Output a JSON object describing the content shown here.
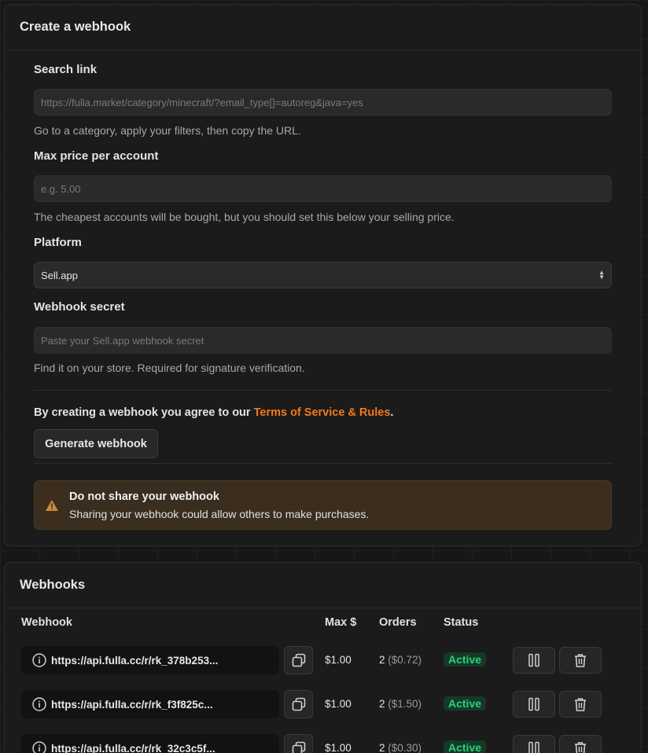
{
  "create": {
    "title": "Create a webhook",
    "search_link": {
      "label": "Search link",
      "placeholder": "https://fulla.market/category/minecraft/?email_type[]=autoreg&java=yes",
      "help": "Go to a category, apply your filters, then copy the URL."
    },
    "max_price": {
      "label": "Max price per account",
      "placeholder": "e.g. 5.00",
      "help": "The cheapest accounts will be bought, but you should set this below your selling price."
    },
    "platform": {
      "label": "Platform",
      "selected": "Sell.app"
    },
    "secret": {
      "label": "Webhook secret",
      "placeholder": "Paste your Sell.app webhook secret",
      "help": "Find it on your store. Required for signature verification."
    },
    "agree_text": "By creating a webhook you agree to our ",
    "agree_link": "Terms of Service & Rules",
    "agree_end": ".",
    "generate_label": "Generate webhook",
    "alert": {
      "title": "Do not share your webhook",
      "text": "Sharing your webhook could allow others to make purchases."
    },
    "colors": {
      "accent": "#f07a1e",
      "warning_bg": "#3b2e1f",
      "active": "#2ad27a"
    }
  },
  "webhooks": {
    "title": "Webhooks",
    "columns": [
      "Webhook",
      "Max $",
      "Orders",
      "Status"
    ],
    "rows": [
      {
        "url": "https://api.fulla.cc/r/rk_378b253...",
        "max": "$1.00",
        "orders": "2",
        "orders_total": "($0.72)",
        "status": "Active"
      },
      {
        "url": "https://api.fulla.cc/r/rk_f3f825c...",
        "max": "$1.00",
        "orders": "2",
        "orders_total": "($1.50)",
        "status": "Active"
      },
      {
        "url": "https://api.fulla.cc/r/rk_32c3c5f...",
        "max": "$1.00",
        "orders": "2",
        "orders_total": "($0.30)",
        "status": "Active"
      }
    ]
  }
}
